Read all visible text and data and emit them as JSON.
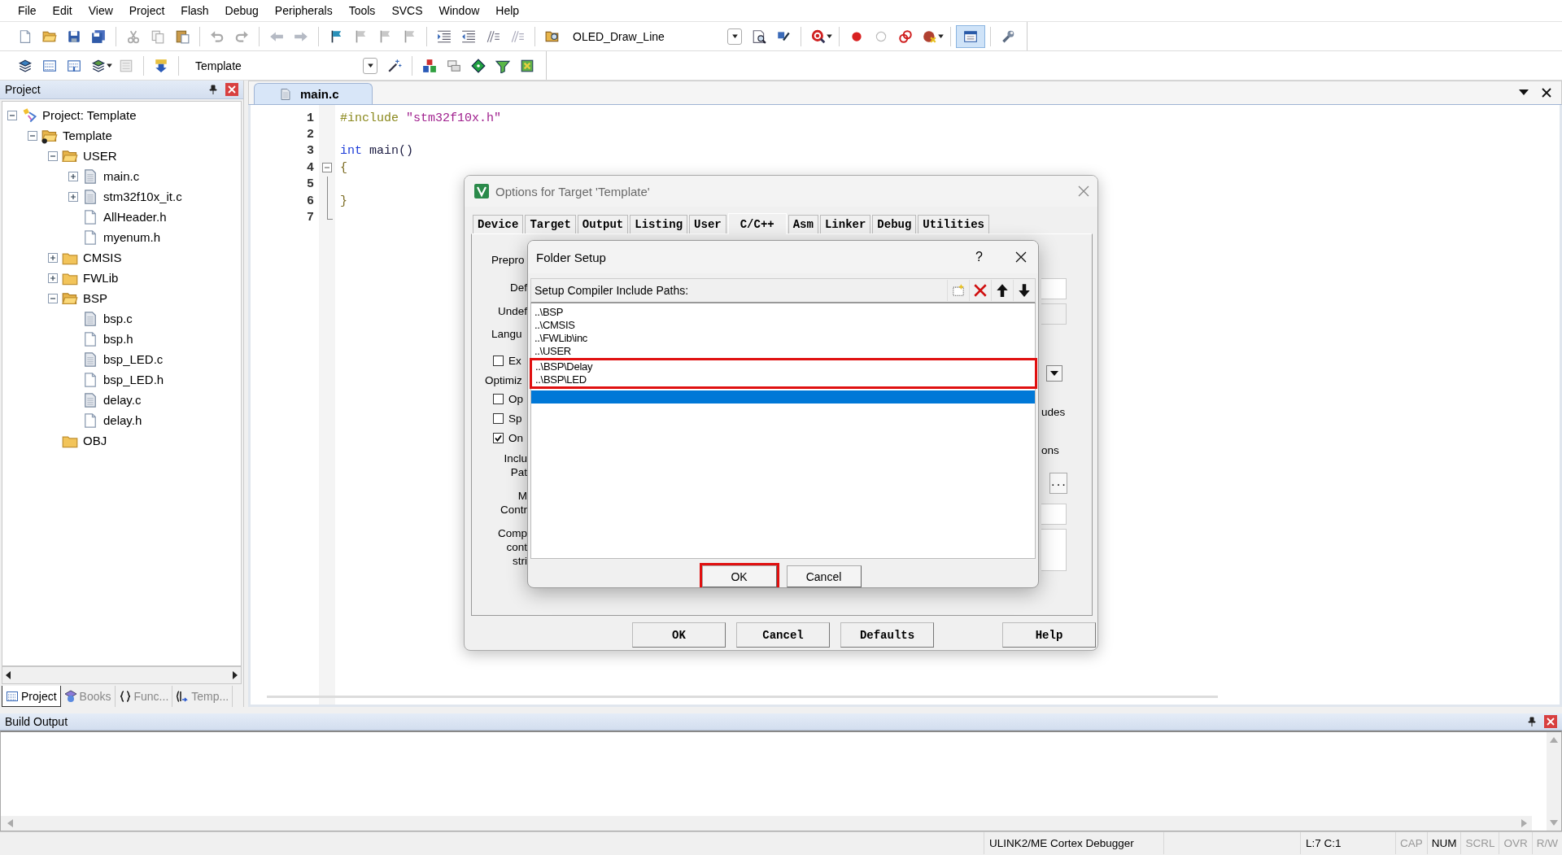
{
  "menu": [
    {
      "label": "File"
    },
    {
      "label": "Edit"
    },
    {
      "label": "View"
    },
    {
      "label": "Project"
    },
    {
      "label": "Flash"
    },
    {
      "label": "Debug"
    },
    {
      "label": "Peripherals"
    },
    {
      "label": "Tools"
    },
    {
      "label": "SVCS"
    },
    {
      "label": "Window"
    },
    {
      "label": "Help"
    }
  ],
  "toolbar": {
    "target_combo": "OLED_Draw_Line"
  },
  "build_toolbar": {
    "target_combo": "Template"
  },
  "project_panel": {
    "title": "Project",
    "tree": [
      {
        "label": "Project: Template",
        "kind": "project",
        "expanded": true,
        "children": [
          {
            "label": "Template",
            "kind": "target",
            "expanded": true,
            "children": [
              {
                "label": "USER",
                "kind": "folder",
                "expanded": true,
                "children": [
                  {
                    "label": "main.c",
                    "kind": "source",
                    "expanded": false
                  },
                  {
                    "label": "stm32f10x_it.c",
                    "kind": "source",
                    "expanded": false
                  },
                  {
                    "label": "AllHeader.h",
                    "kind": "header"
                  },
                  {
                    "label": "myenum.h",
                    "kind": "header"
                  }
                ]
              },
              {
                "label": "CMSIS",
                "kind": "folder",
                "expanded": false
              },
              {
                "label": "FWLib",
                "kind": "folder",
                "expanded": false
              },
              {
                "label": "BSP",
                "kind": "folder",
                "expanded": true,
                "children": [
                  {
                    "label": "bsp.c",
                    "kind": "source"
                  },
                  {
                    "label": "bsp.h",
                    "kind": "header"
                  },
                  {
                    "label": "bsp_LED.c",
                    "kind": "source"
                  },
                  {
                    "label": "bsp_LED.h",
                    "kind": "header"
                  },
                  {
                    "label": "delay.c",
                    "kind": "source"
                  },
                  {
                    "label": "delay.h",
                    "kind": "header"
                  }
                ]
              },
              {
                "label": "OBJ",
                "kind": "folder"
              }
            ]
          }
        ]
      }
    ],
    "tabs": [
      {
        "label": "Project",
        "kind": "project",
        "selected": true
      },
      {
        "label": "Books",
        "kind": "books",
        "selected": false
      },
      {
        "label": "Func...",
        "kind": "functions",
        "selected": false
      },
      {
        "label": "Temp...",
        "kind": "templates",
        "selected": false
      }
    ]
  },
  "editor": {
    "tabs": [
      {
        "label": "main.c",
        "selected": true
      }
    ],
    "lines": [
      {
        "number": "1",
        "tokens": [
          {
            "kind": "preprocessor",
            "text": "#include"
          },
          {
            "kind": "string",
            "text": "\"stm32f10x.h\""
          }
        ]
      },
      {
        "number": "2"
      },
      {
        "number": "3",
        "tokens": [
          {
            "kind": "keyword",
            "text": "int"
          },
          {
            "kind": "plain",
            "text": "main()"
          }
        ]
      },
      {
        "number": "4",
        "fold_start": true,
        "tokens": [
          {
            "kind": "brace",
            "text": "{"
          }
        ]
      },
      {
        "number": "5",
        "fold_line": true
      },
      {
        "number": "6",
        "fold_line": true,
        "tokens": [
          {
            "kind": "brace",
            "text": "}"
          }
        ]
      },
      {
        "number": "7",
        "fold_line": true
      }
    ]
  },
  "options_dialog": {
    "title": "Options for Target 'Template'",
    "tabs": [
      {
        "label": "Device",
        "selected": false
      },
      {
        "label": "Target",
        "selected": false
      },
      {
        "label": "Output",
        "selected": false
      },
      {
        "label": "Listing",
        "selected": false
      },
      {
        "label": "User",
        "selected": false
      },
      {
        "label": "C/C++",
        "selected": true
      },
      {
        "label": "Asm",
        "selected": false
      },
      {
        "label": "Linker",
        "selected": false
      },
      {
        "label": "Debug",
        "selected": false
      },
      {
        "label": "Utilities",
        "selected": false
      }
    ],
    "left_fragments": [
      {
        "kind": "group",
        "lines": [
          "Prepro"
        ]
      },
      {
        "kind": "label",
        "lines": [
          "Def"
        ]
      },
      {
        "kind": "label",
        "lines": [
          "Undef"
        ]
      },
      {
        "kind": "group",
        "lines": [
          "Langu"
        ]
      },
      {
        "kind": "checkbox",
        "lines": [
          "Ex"
        ],
        "checked": false
      },
      {
        "kind": "heading",
        "lines": [
          "Optimiz"
        ]
      },
      {
        "kind": "checkbox",
        "lines": [
          "Op"
        ],
        "checked": false
      },
      {
        "kind": "checkbox",
        "lines": [
          "Sp"
        ],
        "checked": false
      },
      {
        "kind": "checkbox",
        "lines": [
          "On"
        ],
        "checked": true
      },
      {
        "kind": "label",
        "lines": [
          "Inclu",
          "Pat"
        ]
      },
      {
        "kind": "label",
        "lines": [
          "M",
          "Contr"
        ]
      },
      {
        "kind": "label",
        "lines": [
          "Comp",
          "cont",
          "stri"
        ]
      }
    ],
    "right_fragments": [
      {
        "text": "udes"
      },
      {
        "text": "ons"
      }
    ],
    "browse_button": "...",
    "buttons": [
      {
        "label": "OK"
      },
      {
        "label": "Cancel"
      },
      {
        "label": "Defaults"
      },
      {
        "label": "Help"
      }
    ]
  },
  "folder_dialog": {
    "title": "Folder Setup",
    "help_button": "?",
    "list_label": "Setup Compiler Include Paths:",
    "paths": [
      {
        "text": "..\\BSP",
        "selected": false,
        "highlighted": false
      },
      {
        "text": "..\\CMSIS",
        "selected": false,
        "highlighted": false
      },
      {
        "text": "..\\FWLib\\inc",
        "selected": false,
        "highlighted": false
      },
      {
        "text": "..\\USER",
        "selected": false,
        "highlighted": false
      },
      {
        "text": "..\\BSP\\Delay",
        "selected": false,
        "highlighted": true
      },
      {
        "text": "..\\BSP\\LED",
        "selected": false,
        "highlighted": true
      },
      {
        "selected": true,
        "highlighted": false
      }
    ],
    "buttons": [
      {
        "label": "OK",
        "highlighted": true
      },
      {
        "label": "Cancel",
        "highlighted": false
      }
    ]
  },
  "build_output": {
    "title": "Build Output"
  },
  "status_bar": {
    "panes": [
      {
        "text": "ULINK2/ME Cortex Debugger"
      },
      {
        "text": "L:7 C:1"
      }
    ],
    "indicators": [
      {
        "label": "CAP",
        "on": false
      },
      {
        "label": "NUM",
        "on": true
      },
      {
        "label": "SCRL",
        "on": false
      },
      {
        "label": "OVR",
        "on": false
      },
      {
        "label": "R/W",
        "on": false
      }
    ]
  }
}
